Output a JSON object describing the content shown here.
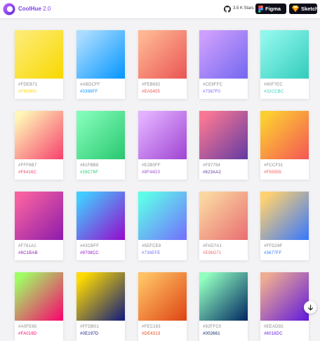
{
  "header": {
    "brand": "CoolHue",
    "version": "2.0",
    "github_stars": "3.5 K Stars",
    "figma_label": "Figma",
    "sketch_label": "Sketch"
  },
  "gradients": [
    {
      "from": "#FDEB71",
      "to": "#F8D800"
    },
    {
      "from": "#ABDCFF",
      "to": "#0396FF"
    },
    {
      "from": "#FEB692",
      "to": "#EA5455"
    },
    {
      "from": "#CE9FFC",
      "to": "#7367F0"
    },
    {
      "from": "#90F7EC",
      "to": "#32CCBC"
    },
    {
      "from": "#FFF6B7",
      "to": "#F6416C"
    },
    {
      "from": "#81FBB8",
      "to": "#28C76F"
    },
    {
      "from": "#E2B0FF",
      "to": "#9F44D3"
    },
    {
      "from": "#F97794",
      "to": "#623AA2"
    },
    {
      "from": "#FCCF31",
      "to": "#F55555"
    },
    {
      "from": "#F761A1",
      "to": "#8C1BAB"
    },
    {
      "from": "#43CBFF",
      "to": "#9708CC"
    },
    {
      "from": "#5EFCE8",
      "to": "#736EFE"
    },
    {
      "from": "#FAD7A1",
      "to": "#E96D71"
    },
    {
      "from": "#FFD26F",
      "to": "#3677FF"
    },
    {
      "from": "#A0FE65",
      "to": "#FA016D"
    },
    {
      "from": "#FFDB01",
      "to": "#0E197D"
    },
    {
      "from": "#FEC163",
      "to": "#DE4313"
    },
    {
      "from": "#92FFC0",
      "to": "#002661"
    },
    {
      "from": "#EEAD92",
      "to": "#6018DC"
    }
  ]
}
